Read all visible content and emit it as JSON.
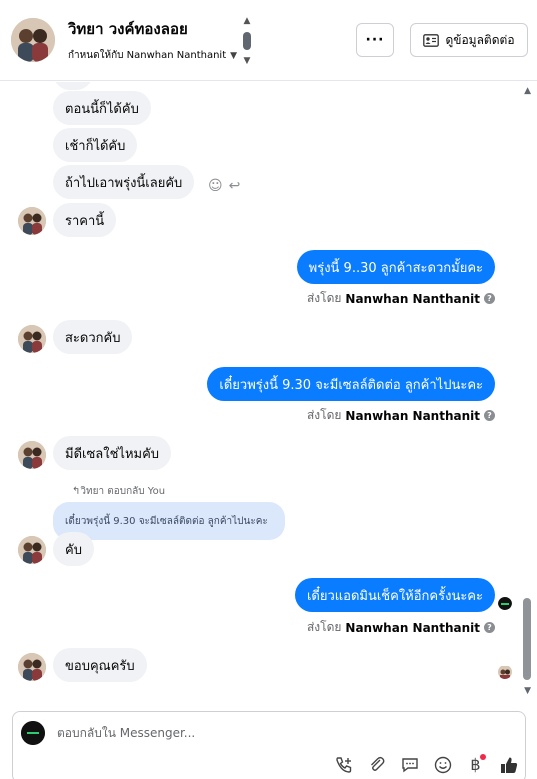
{
  "header": {
    "contact_name": "วิทยา วงค์ทองลอย",
    "assigned_to": "กำหนดให้กับ Nanwhan Nanthanit",
    "more_label": "···",
    "contact_info_label": "ดูข้อมูลติดต่อ"
  },
  "messages": [
    {
      "dir": "in",
      "text": "ตอนนี้ก็ได้คับ"
    },
    {
      "dir": "in",
      "text": "เช้าก็ได้คับ"
    },
    {
      "dir": "in",
      "text": "ถ้าไปเอาพรุ่งนี้เลยคับ"
    },
    {
      "dir": "in",
      "text": "ราคานี้"
    },
    {
      "dir": "out",
      "text": "พรุ่งนี้ 9..30 ลูกค้าสะดวกมั้ยคะ",
      "sent_prefix": "ส่งโดย",
      "sent_by": "Nanwhan Nanthanit"
    },
    {
      "dir": "in",
      "text": "สะดวกคับ"
    },
    {
      "dir": "out",
      "text": "เดี๋ยวพรุ่งนี้ 9.30 จะมีเซลล์ติดต่อ ลูกค้าไปนะคะ",
      "sent_prefix": "ส่งโดย",
      "sent_by": "Nanwhan Nanthanit"
    },
    {
      "dir": "in",
      "text": "มีดีเซลใช่ไหมคับ"
    },
    {
      "dir": "in",
      "text": "คับ",
      "reply_label": "↰วิทยา ตอบกลับ You",
      "quoted": "เดี๋ยวพรุ่งนี้ 9.30 จะมีเซลล์ติดต่อ ลูกค้าไปนะคะ"
    },
    {
      "dir": "out",
      "text": "เดี๋ยวแอดมินเช็คให้อีกครั้งนะคะ",
      "sent_prefix": "ส่งโดย",
      "sent_by": "Nanwhan Nanthanit"
    },
    {
      "dir": "in",
      "text": "ขอบคุณครับ"
    }
  ],
  "composer": {
    "placeholder": "ตอบกลับใน Messenger..."
  },
  "icons": {
    "tools": [
      "call-icon",
      "attachment-icon",
      "saved-replies-icon",
      "emoji-icon",
      "payment-icon",
      "like-icon"
    ]
  },
  "colors": {
    "outgoing": "#0a7cff",
    "incoming": "#f0f2f5",
    "quoted": "#dbe7fb"
  }
}
